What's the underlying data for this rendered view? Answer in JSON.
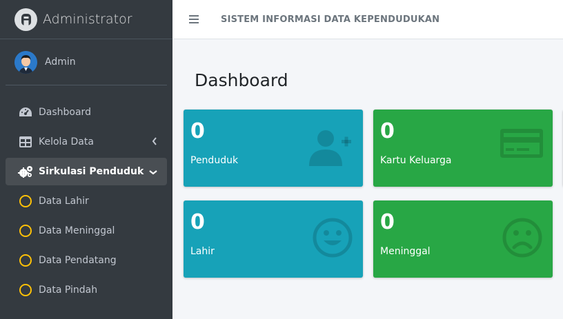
{
  "sidebar": {
    "brand": "Administrator",
    "user": "Admin",
    "items": [
      {
        "label": "Dashboard",
        "icon": "tachometer-icon"
      },
      {
        "label": "Kelola Data",
        "icon": "table-icon"
      },
      {
        "label": "Sirkulasi Penduduk",
        "icon": "cogs-icon"
      }
    ],
    "subitems": [
      {
        "label": "Data Lahir"
      },
      {
        "label": "Data Meninggal"
      },
      {
        "label": "Data Pendatang"
      },
      {
        "label": "Data Pindah"
      }
    ]
  },
  "header": {
    "title": "SISTEM INFORMASI DATA KEPENDUDUKAN"
  },
  "main": {
    "page_title": "Dashboard",
    "boxes": [
      {
        "value": "0",
        "label": "Penduduk",
        "icon": "user-plus-icon",
        "color": "#17a2b8"
      },
      {
        "value": "0",
        "label": "Kartu Keluarga",
        "icon": "credit-card-icon",
        "color": "#28a745"
      },
      {
        "value": "0",
        "label": "Lahir",
        "icon": "smile-icon",
        "color": "#17a2b8"
      },
      {
        "value": "0",
        "label": "Meninggal",
        "icon": "frown-icon",
        "color": "#28a745"
      }
    ]
  }
}
